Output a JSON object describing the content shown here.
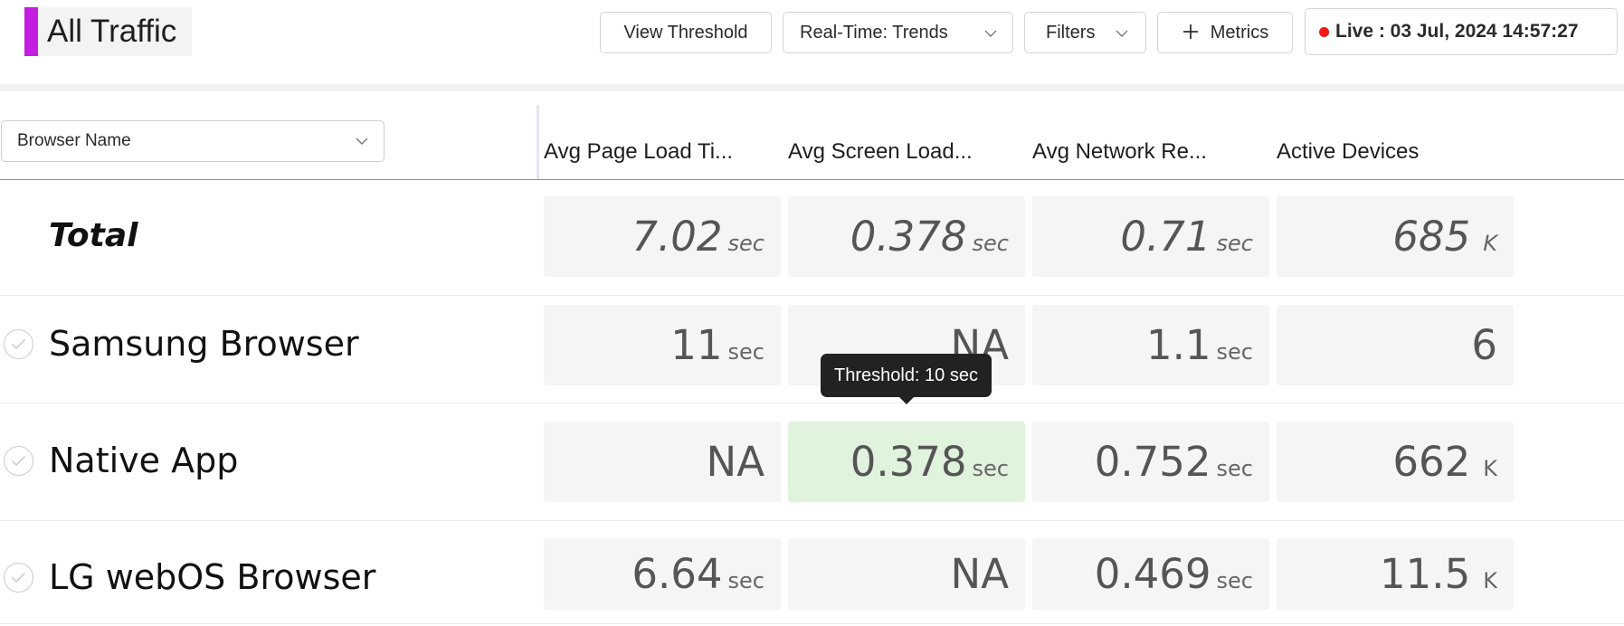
{
  "header": {
    "title": "All Traffic",
    "accent_color": "#c41ee0",
    "view_threshold_label": "View Threshold",
    "realtime_label": "Real-Time: Trends",
    "filters_label": "Filters",
    "metrics_label": "Metrics",
    "live_label": "Live : 03 Jul, 2024 14:57:27",
    "live_dot_color": "#f21818"
  },
  "table": {
    "group_by": "Browser Name",
    "columns": [
      "Avg Page Load Ti...",
      "Avg Screen Load...",
      "Avg Network Re...",
      "Active Devices"
    ],
    "total": {
      "label": "Total",
      "cells": [
        {
          "value": "7.02",
          "unit": "sec"
        },
        {
          "value": "0.378",
          "unit": "sec"
        },
        {
          "value": "0.71",
          "unit": "sec"
        },
        {
          "value": "685",
          "unit": "K"
        }
      ]
    },
    "rows": [
      {
        "label": "Samsung Browser",
        "cells": [
          {
            "value": "11",
            "unit": "sec"
          },
          {
            "value": "NA",
            "unit": ""
          },
          {
            "value": "1.1",
            "unit": "sec"
          },
          {
            "value": "6",
            "unit": ""
          }
        ]
      },
      {
        "label": "Native App",
        "cells": [
          {
            "value": "NA",
            "unit": ""
          },
          {
            "value": "0.378",
            "unit": "sec"
          },
          {
            "value": "0.752",
            "unit": "sec"
          },
          {
            "value": "662",
            "unit": "K"
          }
        ]
      },
      {
        "label": "LG webOS Browser",
        "cells": [
          {
            "value": "6.64",
            "unit": "sec"
          },
          {
            "value": "NA",
            "unit": ""
          },
          {
            "value": "0.469",
            "unit": "sec"
          },
          {
            "value": "11.5",
            "unit": "K"
          }
        ]
      }
    ],
    "highlight_color": "#dff3dd"
  },
  "tooltip": {
    "text": "Threshold: 10 sec"
  },
  "icons": {
    "chevron": "chevron-down-icon",
    "plus": "plus-icon",
    "live": "live-dot-icon",
    "row_check": "check-circle-icon"
  }
}
